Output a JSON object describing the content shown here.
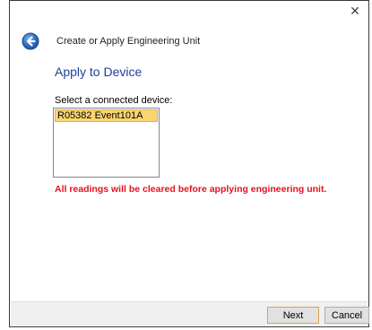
{
  "window": {
    "close_glyph": "✕"
  },
  "header": {
    "back_icon": "back-arrow-icon",
    "wizard_title": "Create or Apply Engineering Unit"
  },
  "page": {
    "heading": "Apply to Device",
    "list_label": "Select a connected device:",
    "devices": [
      {
        "name": "R05382 Event101A",
        "selected": true
      }
    ],
    "warning": "All readings will be cleared before applying engineering unit."
  },
  "footer": {
    "next_label": "Next",
    "cancel_label": "Cancel"
  },
  "colors": {
    "heading": "#1f3f9a",
    "warning": "#e8101c",
    "selection": "#fbd572",
    "back_button": "#2f6cc4"
  }
}
